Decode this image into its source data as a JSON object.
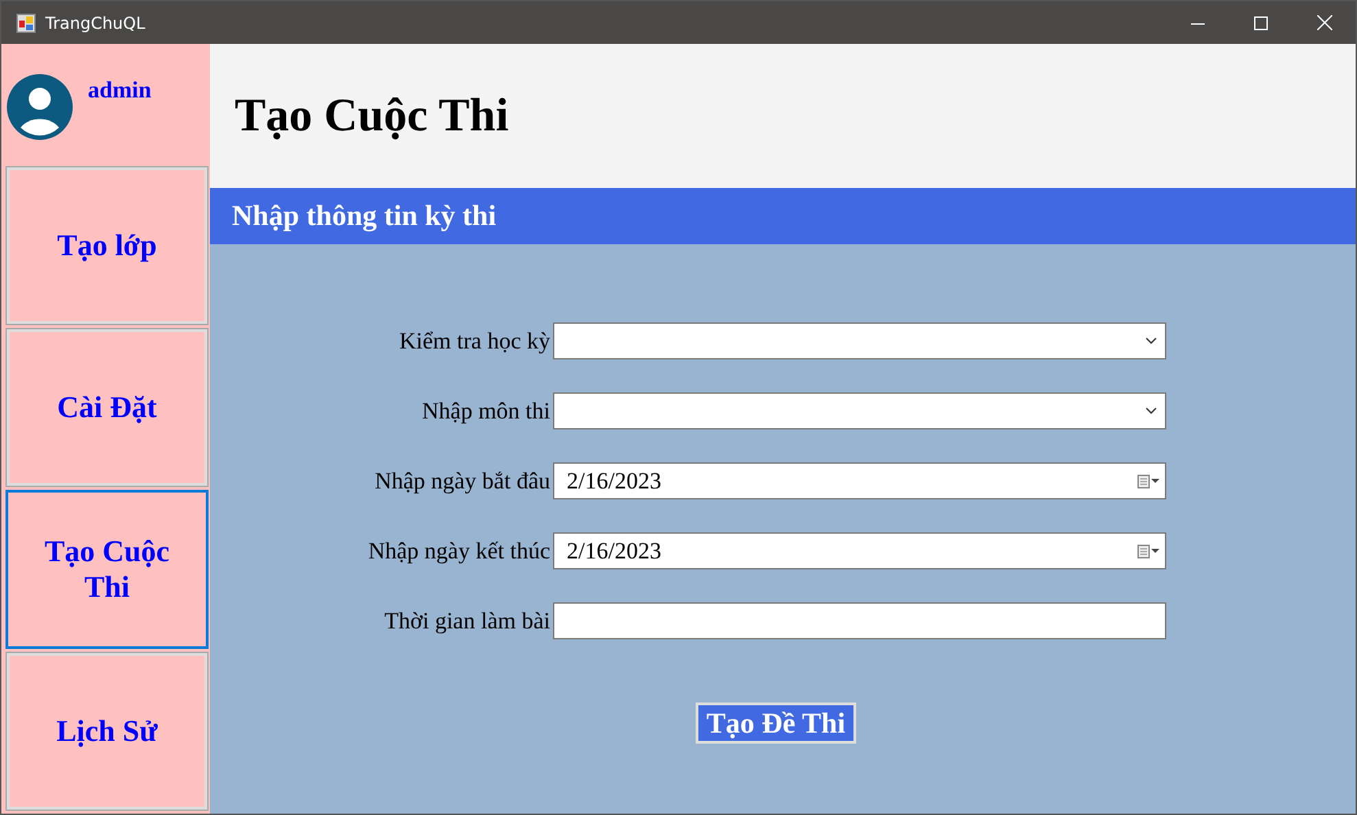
{
  "window": {
    "title": "TrangChuQL"
  },
  "sidebar": {
    "user": "admin",
    "items": [
      {
        "label": "Tạo lớp",
        "selected": false
      },
      {
        "label": "Cài Đặt",
        "selected": false
      },
      {
        "label": "Tạo Cuộc Thi",
        "selected": true
      },
      {
        "label": "Lịch Sử",
        "selected": false
      }
    ]
  },
  "header": {
    "title": "Tạo Cuộc Thi"
  },
  "section": {
    "title": "Nhập thông tin kỳ thi"
  },
  "form": {
    "fields": [
      {
        "label": "Kiểm tra học kỳ",
        "kind": "combo"
      },
      {
        "label": "Nhập môn thi",
        "kind": "combo"
      },
      {
        "label": "Nhập ngày bắt đâu",
        "kind": "date",
        "value": "2/16/2023"
      },
      {
        "label": "Nhập ngày kết thúc",
        "kind": "date",
        "value": "2/16/2023"
      },
      {
        "label": "Thời gian làm bài",
        "kind": "text"
      }
    ],
    "submit": "Tạo Đề Thi"
  }
}
